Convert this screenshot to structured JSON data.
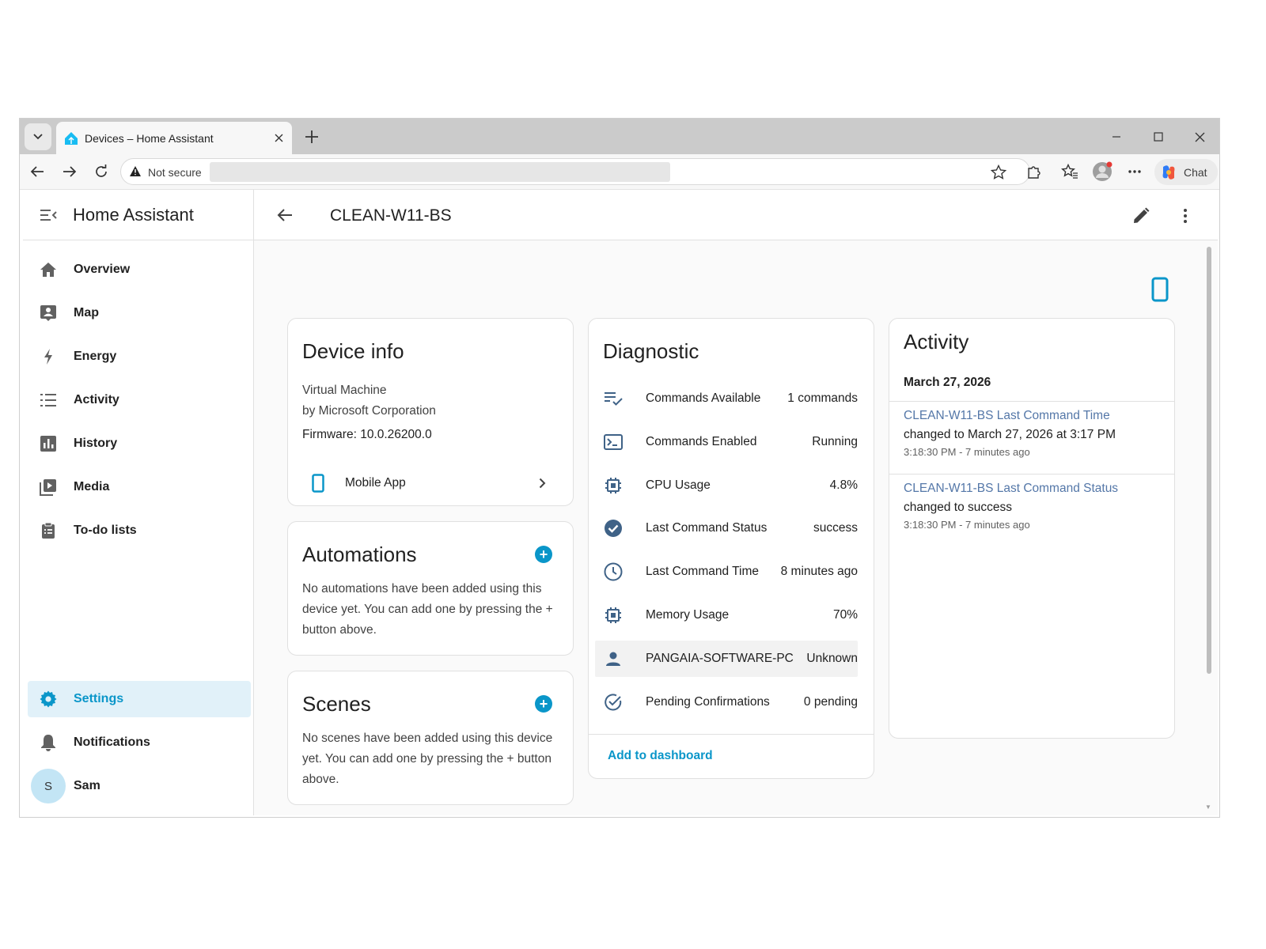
{
  "browser": {
    "tab_title": "Devices – Home Assistant",
    "security_label": "Not secure",
    "chat_label": "Chat"
  },
  "sidebar": {
    "title": "Home Assistant",
    "items": [
      {
        "label": "Overview",
        "icon": "home-icon"
      },
      {
        "label": "Map",
        "icon": "map-icon"
      },
      {
        "label": "Energy",
        "icon": "lightning-icon"
      },
      {
        "label": "Activity",
        "icon": "list-icon"
      },
      {
        "label": "History",
        "icon": "chart-icon"
      },
      {
        "label": "Media",
        "icon": "media-icon"
      },
      {
        "label": "To-do lists",
        "icon": "clipboard-icon"
      }
    ],
    "settings_label": "Settings",
    "notifications_label": "Notifications",
    "user_initial": "S",
    "user_name": "Sam"
  },
  "header": {
    "title": "CLEAN-W11-BS"
  },
  "device_info": {
    "title": "Device info",
    "model": "Virtual Machine",
    "manufacturer": "by Microsoft Corporation",
    "firmware": "Firmware: 10.0.26200.0",
    "integration_label": "Mobile App"
  },
  "automations": {
    "title": "Automations",
    "empty_text": "No automations have been added using this device yet. You can add one by pressing the + button above."
  },
  "scenes": {
    "title": "Scenes",
    "empty_text": "No scenes have been added using this device yet. You can add one by pressing the + button above."
  },
  "diagnostic": {
    "title": "Diagnostic",
    "rows": [
      {
        "name": "Commands Available",
        "value": "1 commands",
        "icon": "list-check-icon"
      },
      {
        "name": "Commands Enabled",
        "value": "Running",
        "icon": "console-icon"
      },
      {
        "name": "CPU Usage",
        "value": "4.8%",
        "icon": "cpu-icon"
      },
      {
        "name": "Last Command Status",
        "value": "success",
        "icon": "check-circle-icon"
      },
      {
        "name": "Last Command Time",
        "value": "8 minutes ago",
        "icon": "clock-icon"
      },
      {
        "name": "Memory Usage",
        "value": "70%",
        "icon": "chip-icon"
      },
      {
        "name": "PANGAIA-SOFTWARE-PC",
        "value": "Unknown",
        "icon": "account-icon"
      },
      {
        "name": "Pending Confirmations",
        "value": "0 pending",
        "icon": "check-circle-outline-icon"
      }
    ],
    "add_to_dashboard": "Add to dashboard"
  },
  "activity": {
    "title": "Activity",
    "date": "March 27, 2026",
    "entries": [
      {
        "entity": "CLEAN-W11-BS Last Command Time",
        "change": "changed to March 27, 2026 at 3:17 PM",
        "time": "3:18:30 PM - 7 minutes ago"
      },
      {
        "entity": "CLEAN-W11-BS Last Command Status",
        "change": "changed to success",
        "time": "3:18:30 PM - 7 minutes ago"
      }
    ]
  },
  "colors": {
    "accent": "#0a96c9",
    "icon_grey": "#616161",
    "diag_icon": "#3f6287",
    "link": "#5477a8",
    "active_bg": "#e1f1f9"
  }
}
